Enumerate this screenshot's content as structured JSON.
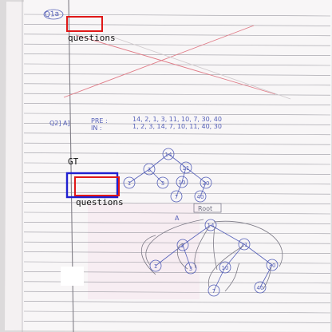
{
  "page": {
    "heading_scrawl": "Q1a"
  },
  "q2": {
    "label": "Q2] A]",
    "pre_label": "PRE :",
    "pre_values": "14, 2, 1, 3, 11, 10, 7, 30, 40",
    "in_label": "IN :",
    "in_values": "1, 2, 3, 14, 7, 10, 11, 40, 30"
  },
  "tree1": {
    "nodes": [
      "14",
      "2",
      "11",
      "1",
      "3",
      "10",
      "30",
      "7",
      "40"
    ]
  },
  "tree2": {
    "root_tag": "Root",
    "side_mark": "A",
    "nodes": [
      "14",
      "2",
      "11",
      "1",
      "3",
      "10",
      "30",
      "7",
      "40"
    ]
  },
  "annotations": {
    "label_top": "questions",
    "label_gt": "GT",
    "label_bottom": "questions",
    "colors": {
      "red": "#e01818",
      "blue": "#2020d0",
      "white": "#ffffff"
    }
  }
}
